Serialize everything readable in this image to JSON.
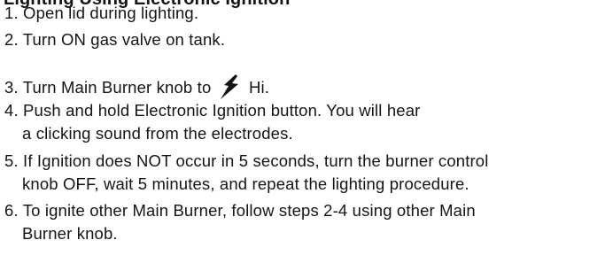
{
  "document": {
    "heading": "Lighting Using Electronic Ignition",
    "steps": [
      {
        "number": "1.",
        "text": "Open lid during lighting."
      },
      {
        "number": "2.",
        "text": "Turn ON gas valve on tank."
      },
      {
        "number": "3.",
        "text_before": "Turn Main Burner knob to",
        "icon": "lightning-bolt-icon",
        "text_after": "Hi."
      },
      {
        "number": "4.",
        "text": "Push and hold Electronic Ignition button. You will hear",
        "continuation": "a clicking sound from the electrodes."
      },
      {
        "number": "5.",
        "text": "If Ignition does NOT occur in 5 seconds, turn the burner control",
        "continuation": "knob OFF, wait 5 minutes, and repeat the lighting procedure."
      },
      {
        "number": "6.",
        "text": "To ignite other Main Burner, follow steps 2-4 using other Main",
        "continuation": "Burner knob."
      }
    ]
  }
}
